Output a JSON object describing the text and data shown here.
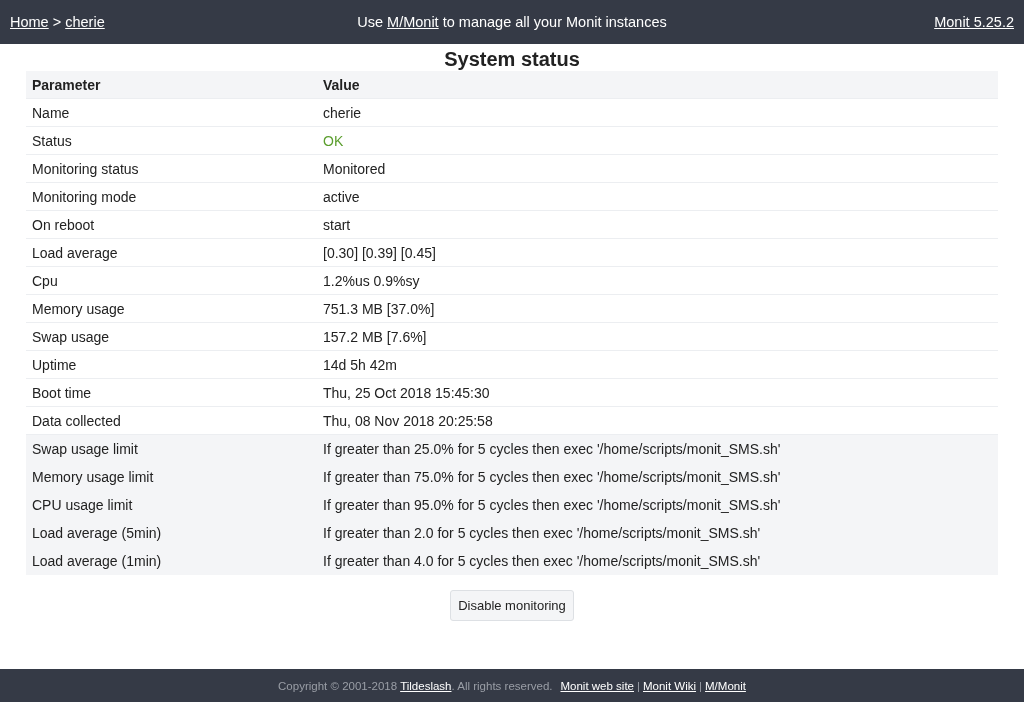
{
  "header": {
    "breadcrumb": [
      {
        "label": "Home"
      },
      {
        "label": "cherie"
      }
    ],
    "breadcrumb_separator": ">",
    "notice": {
      "before": "Use ",
      "link": "M/Monit",
      "after": " to manage all your Monit instances"
    },
    "version": "Monit 5.25.2"
  },
  "title": "System status",
  "table": {
    "columns": [
      "Parameter",
      "Value"
    ],
    "rows": [
      {
        "kind": "info",
        "parameter": "Name",
        "value": "cherie"
      },
      {
        "kind": "ok",
        "parameter": "Status",
        "value": "OK"
      },
      {
        "kind": "info",
        "parameter": "Monitoring status",
        "value": "Monitored"
      },
      {
        "kind": "info",
        "parameter": "Monitoring mode",
        "value": "active"
      },
      {
        "kind": "info",
        "parameter": "On reboot",
        "value": "start"
      },
      {
        "kind": "info",
        "parameter": "Load average",
        "value": "[0.30] [0.39] [0.45]"
      },
      {
        "kind": "info",
        "parameter": "Cpu",
        "value": "1.2%us 0.9%sy"
      },
      {
        "kind": "info",
        "parameter": "Memory usage",
        "value": "751.3 MB [37.0%]"
      },
      {
        "kind": "info",
        "parameter": "Swap usage",
        "value": "157.2 MB [7.6%]"
      },
      {
        "kind": "info",
        "parameter": "Uptime",
        "value": "14d 5h 42m"
      },
      {
        "kind": "info",
        "parameter": "Boot time",
        "value": "Thu, 25 Oct 2018 15:45:30"
      },
      {
        "kind": "info",
        "parameter": "Data collected",
        "value": "Thu, 08 Nov 2018 20:25:58"
      },
      {
        "kind": "rule",
        "parameter": "Swap usage limit",
        "value": "If greater than 25.0% for 5 cycles then exec '/home/scripts/monit_SMS.sh'"
      },
      {
        "kind": "rule",
        "parameter": "Memory usage limit",
        "value": "If greater than 75.0% for 5 cycles then exec '/home/scripts/monit_SMS.sh'"
      },
      {
        "kind": "rule",
        "parameter": "CPU usage limit",
        "value": "If greater than 95.0% for 5 cycles then exec '/home/scripts/monit_SMS.sh'"
      },
      {
        "kind": "rule",
        "parameter": "Load average (5min)",
        "value": "If greater than 2.0 for 5 cycles then exec '/home/scripts/monit_SMS.sh'"
      },
      {
        "kind": "rule",
        "parameter": "Load average (1min)",
        "value": "If greater than 4.0 for 5 cycles then exec '/home/scripts/monit_SMS.sh'"
      }
    ]
  },
  "action_button": "Disable monitoring",
  "footer": {
    "copyright_before": "Copyright © 2001-2018 ",
    "copyright_link": "Tildeslash",
    "copyright_after": ". All rights reserved.",
    "links": [
      "Monit web site",
      "Monit Wiki",
      "M/Monit"
    ],
    "link_separator": "|"
  }
}
